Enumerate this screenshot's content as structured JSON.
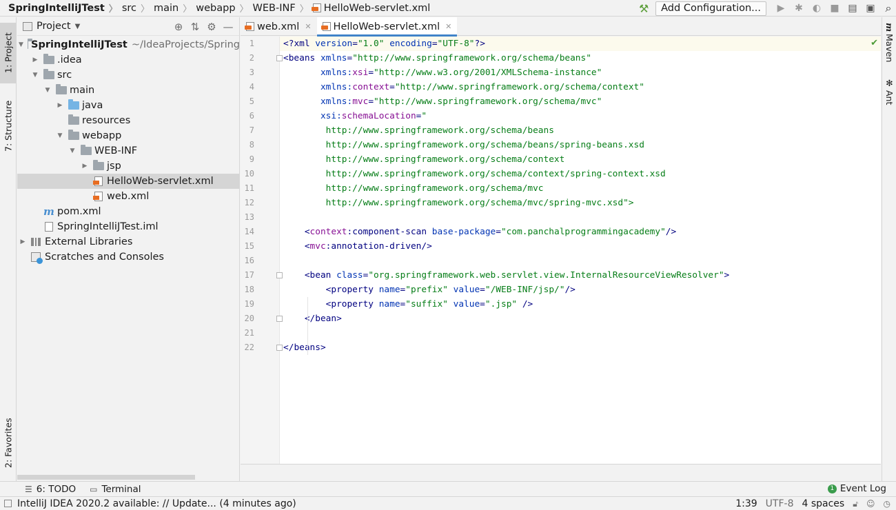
{
  "breadcrumb": [
    "SpringIntelliJTest",
    "src",
    "main",
    "webapp",
    "WEB-INF",
    "HelloWeb-servlet.xml"
  ],
  "toolbar": {
    "add_configuration": "Add Configuration..."
  },
  "left_tabs": {
    "project": "1: Project",
    "structure": "7: Structure",
    "favorites": "2: Favorites"
  },
  "right_tabs": {
    "maven": "Maven",
    "ant": "Ant"
  },
  "project_panel": {
    "title": "Project"
  },
  "tree": {
    "root_name": "SpringIntelliJTest",
    "root_path": "~/IdeaProjects/Spring",
    "items": [
      "SpringIntelliJTest",
      ".idea",
      "src",
      "main",
      "java",
      "resources",
      "webapp",
      "WEB-INF",
      "jsp",
      "HelloWeb-servlet.xml",
      "web.xml",
      "pom.xml",
      "SpringIntelliJTest.iml",
      "External Libraries",
      "Scratches and Consoles"
    ]
  },
  "editor_tabs": [
    {
      "label": "web.xml",
      "active": false
    },
    {
      "label": "HelloWeb-servlet.xml",
      "active": true
    }
  ],
  "code_lines": [
    "<?xml version=\"1.0\" encoding=\"UTF-8\"?>",
    "<beans xmlns=\"http://www.springframework.org/schema/beans\"",
    "       xmlns:xsi=\"http://www.w3.org/2001/XMLSchema-instance\"",
    "       xmlns:context=\"http://www.springframework.org/schema/context\"",
    "       xmlns:mvc=\"http://www.springframework.org/schema/mvc\"",
    "       xsi:schemaLocation=\"",
    "        http://www.springframework.org/schema/beans",
    "        http://www.springframework.org/schema/beans/spring-beans.xsd",
    "        http://www.springframework.org/schema/context",
    "        http://www.springframework.org/schema/context/spring-context.xsd",
    "        http://www.springframework.org/schema/mvc",
    "        http://www.springframework.org/schema/mvc/spring-mvc.xsd\">",
    "",
    "    <context:component-scan base-package=\"com.panchalprogrammingacademy\"/>",
    "    <mvc:annotation-driven/>",
    "",
    "    <bean class=\"org.springframework.web.servlet.view.InternalResourceViewResolver\">",
    "        <property name=\"prefix\" value=\"/WEB-INF/jsp/\"/>",
    "        <property name=\"suffix\" value=\".jsp\" />",
    "    </bean>",
    "",
    "</beans>"
  ],
  "line_numbers": [
    "1",
    "2",
    "3",
    "4",
    "5",
    "6",
    "7",
    "8",
    "9",
    "10",
    "11",
    "12",
    "13",
    "14",
    "15",
    "16",
    "17",
    "18",
    "19",
    "20",
    "21",
    "22"
  ],
  "bottom_tools": {
    "todo": "6: TODO",
    "terminal": "Terminal",
    "event_log": "Event Log",
    "event_count": "1"
  },
  "status": {
    "message": "IntelliJ IDEA 2020.2 available: // Update... (4 minutes ago)",
    "position": "1:39",
    "encoding": "UTF-8",
    "indent": "4 spaces"
  },
  "colors": {
    "accent": "#4083c9",
    "tag": "#000080",
    "attr": "#0033b3",
    "value": "#067d17",
    "namespace": "#871094"
  }
}
